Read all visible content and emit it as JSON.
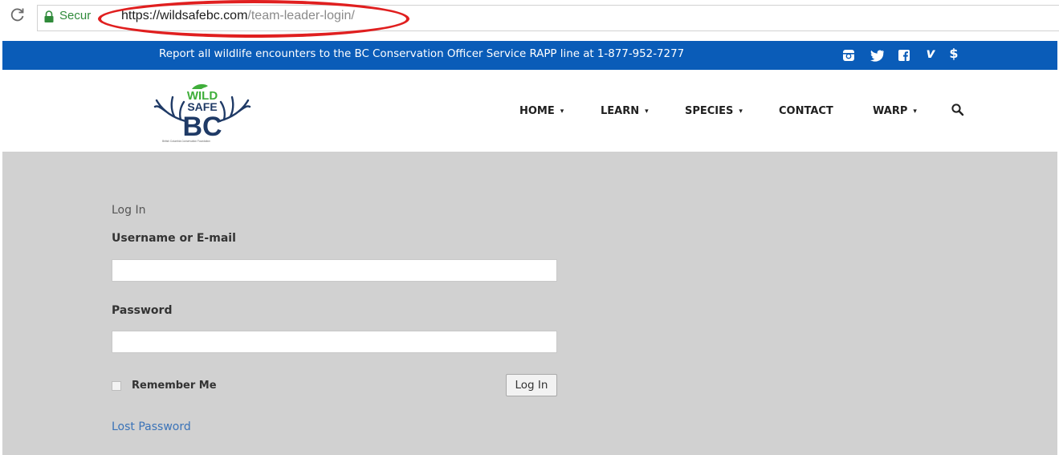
{
  "browser": {
    "secure_label": "Secur",
    "url_host": "https://wildsafebc.com",
    "url_path": "/team-leader-login/",
    "annotation_color": "#e01f1f"
  },
  "banner": {
    "text": "Report all wildlife encounters to the BC Conservation Officer Service RAPP line at 1-877-952-7277",
    "background": "#0a5cb8",
    "social_icons": [
      "instagram-icon",
      "twitter-icon",
      "facebook-icon",
      "vimeo-icon",
      "donate-icon"
    ],
    "donate_symbol": "$",
    "vimeo_symbol": "v"
  },
  "header": {
    "logo_word_top": "WILD",
    "logo_word_mid": "SAFE",
    "logo_word_bottom": "BC",
    "logo_caption": "British Columbia Conservation Foundation",
    "nav": [
      {
        "label": "HOME",
        "has_dropdown": true
      },
      {
        "label": "LEARN",
        "has_dropdown": true
      },
      {
        "label": "SPECIES",
        "has_dropdown": true
      },
      {
        "label": "CONTACT",
        "has_dropdown": false
      },
      {
        "label": "WARP",
        "has_dropdown": true
      }
    ],
    "caret": "▾"
  },
  "login": {
    "title": "Log In",
    "username_label": "Username or E-mail",
    "username_value": "",
    "password_label": "Password",
    "password_value": "",
    "remember_label": "Remember Me",
    "remember_checked": false,
    "submit_label": "Log In",
    "lost_password": "Lost Password"
  },
  "colors": {
    "content_bg": "#d1d1d1",
    "link": "#3a73b8",
    "logo_green": "#3fae3a",
    "logo_navy": "#1f3a66"
  }
}
